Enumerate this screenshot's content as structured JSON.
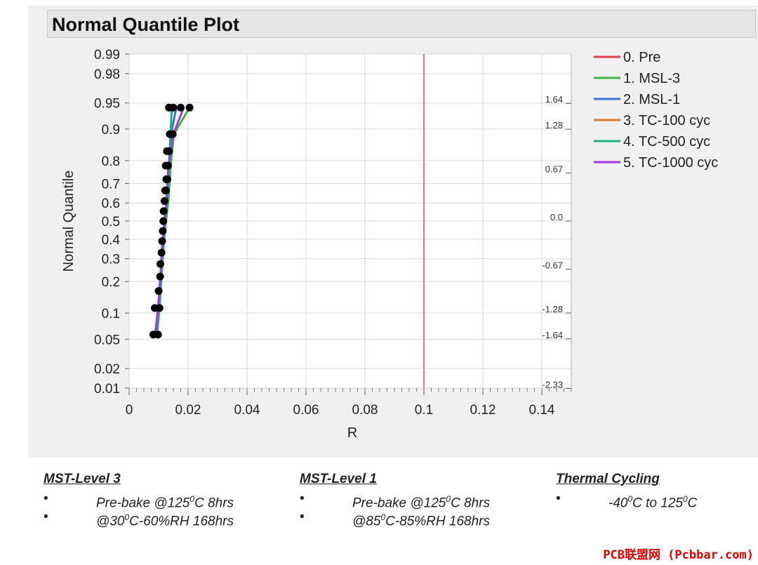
{
  "title": "Normal Quantile Plot",
  "chart_data": {
    "type": "line",
    "xlabel": "R",
    "ylabel": "Normal Quantile",
    "xlim": [
      0,
      0.15
    ],
    "x_ticks": [
      0,
      0.02,
      0.04,
      0.06,
      0.08,
      0.1,
      0.12,
      0.14
    ],
    "x_tick_labels": [
      "0",
      "0.02",
      "0.04",
      "0.06",
      "0.08",
      "0.1",
      "0.12",
      "0.14"
    ],
    "left_prob_ticks": [
      0.01,
      0.02,
      0.05,
      0.1,
      0.2,
      0.3,
      0.4,
      0.5,
      0.6,
      0.7,
      0.8,
      0.9,
      0.95,
      0.98,
      0.99
    ],
    "left_prob_labels": [
      "0.01",
      "0.02",
      "0.05",
      "0.1",
      "0.2",
      "0.3",
      "0.4",
      "0.5",
      "0.6",
      "0.7",
      "0.8",
      "0.9",
      "0.95",
      "0.98",
      "0.99"
    ],
    "right_z_ticks": [
      1.64,
      1.28,
      0.67,
      0.0,
      -0.67,
      -1.28,
      -1.64,
      -2.33
    ],
    "right_z_labels": [
      "1.64",
      "1.28",
      "0.67",
      "0.0",
      "-0.67",
      "-1.28",
      "-1.64",
      "-2.33"
    ],
    "reference_line": {
      "x": 0.1,
      "color": "#e8404a"
    },
    "legend_position": "right",
    "series": [
      {
        "name": "0. Pre",
        "color": "#e03c45",
        "x": [],
        "y": []
      },
      {
        "name": "1. MSL-3",
        "color": "#3fb53f",
        "x": [
          0.0095,
          0.0103,
          0.011,
          0.0118,
          0.0125,
          0.0133,
          0.0141,
          0.0152,
          0.0205
        ],
        "y": [
          0.057,
          0.113,
          0.22,
          0.39,
          0.5,
          0.61,
          0.78,
          0.887,
          0.943
        ]
      },
      {
        "name": "2. MSL-1",
        "color": "#3b6fe0",
        "x": [
          0.0088,
          0.0098,
          0.0107,
          0.0114,
          0.0121,
          0.0128,
          0.0135,
          0.0142,
          0.016
        ],
        "y": [
          0.057,
          0.113,
          0.22,
          0.39,
          0.5,
          0.61,
          0.78,
          0.887,
          0.943
        ]
      },
      {
        "name": "3. TC-100 cyc",
        "color": "#e07b20",
        "x": [],
        "y": []
      },
      {
        "name": "4. TC-500 cyc",
        "color": "#1fb07a",
        "x": [
          0.0092,
          0.01,
          0.0108,
          0.0115,
          0.0122,
          0.013,
          0.0136,
          0.014,
          0.0145
        ],
        "y": [
          0.057,
          0.113,
          0.22,
          0.39,
          0.5,
          0.61,
          0.78,
          0.887,
          0.943
        ]
      },
      {
        "name": "5. TC-1000 cyc",
        "color": "#a238e0",
        "x": [
          0.009,
          0.0098,
          0.0106,
          0.0113,
          0.012,
          0.0127,
          0.0133,
          0.015,
          0.0185
        ],
        "y": [
          0.057,
          0.113,
          0.22,
          0.39,
          0.5,
          0.61,
          0.78,
          0.887,
          0.943
        ]
      }
    ],
    "points": {
      "color": "#000000",
      "x": [
        0.0082,
        0.0098,
        0.0087,
        0.0103,
        0.01,
        0.0105,
        0.0106,
        0.011,
        0.0112,
        0.0114,
        0.0116,
        0.0117,
        0.012,
        0.0122,
        0.0125,
        0.0128,
        0.0126,
        0.013,
        0.0124,
        0.0132,
        0.0128,
        0.0135,
        0.0138,
        0.0148,
        0.0135,
        0.0175,
        0.0205,
        0.015
      ],
      "y": [
        0.057,
        0.057,
        0.113,
        0.113,
        0.165,
        0.22,
        0.275,
        0.33,
        0.39,
        0.445,
        0.5,
        0.555,
        0.61,
        0.665,
        0.665,
        0.72,
        0.72,
        0.72,
        0.78,
        0.78,
        0.835,
        0.835,
        0.887,
        0.887,
        0.943,
        0.943,
        0.943,
        0.943
      ]
    }
  },
  "notes": [
    {
      "heading": "MST-Level 3",
      "bullets": [
        "•",
        "•"
      ],
      "lines": [
        [
          "Pre-bake @125",
          "0",
          "C 8hrs"
        ],
        [
          "@30",
          "0",
          "C-60%RH 168hrs"
        ]
      ]
    },
    {
      "heading": "MST-Level 1",
      "bullets": [
        "•",
        "•"
      ],
      "lines": [
        [
          "Pre-bake @125",
          "0",
          "C 8hrs"
        ],
        [
          "@85",
          "0",
          "C-85%RH 168hrs"
        ]
      ]
    },
    {
      "heading": "Thermal Cycling",
      "bullets": [
        "•"
      ],
      "lines": [
        [
          "-40",
          "0",
          "C to 125",
          "0",
          "C"
        ]
      ]
    }
  ],
  "watermark": "PCB联盟网 (Pcbbar.com)"
}
